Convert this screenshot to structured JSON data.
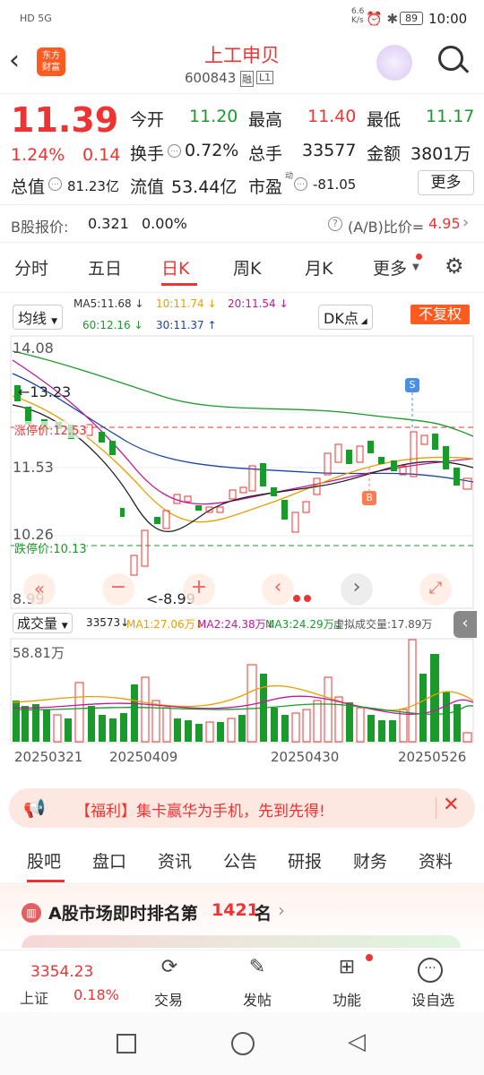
{
  "status": {
    "left_icons": "HD 5G",
    "speed": "6.6\nK/s",
    "battery": "89",
    "time": "10:00"
  },
  "header": {
    "logo": "东方\n财富",
    "title": "上工申贝",
    "code": "600843",
    "badge1": "融",
    "badge2": "L1"
  },
  "quote": {
    "price": "11.39",
    "pct": "1.24%",
    "chg": "0.14",
    "open_label": "今开",
    "open": "11.20",
    "high_label": "最高",
    "high": "11.40",
    "low_label": "最低",
    "low": "11.17",
    "turn_label": "换手",
    "turn": "0.72%",
    "vol_label": "总手",
    "vol": "33577",
    "amt_label": "金额",
    "amt": "3801万",
    "mcap_label": "总值",
    "mcap": "81.23亿",
    "float_label": "流值",
    "float": "53.44亿",
    "pe_label": "市盈",
    "pe_sup": "动",
    "pe": "-81.05",
    "more_btn": "更多"
  },
  "bshare": {
    "label": "B股报价:",
    "price": "0.321",
    "pct": "0.00%",
    "ratio_label": "(A/B)比价=",
    "ratio": "4.95"
  },
  "period_tabs": [
    "分时",
    "五日",
    "日K",
    "周K",
    "月K",
    "更多"
  ],
  "kline": {
    "ma_select": "均线",
    "ma5": "MA5:11.68 ↓",
    "ma10": "10:11.74 ↓",
    "ma20": "20:11.54 ↓",
    "ma60": "60:12.16 ↓",
    "ma30": "30:11.37 ↑",
    "dk": "DK点",
    "fq": "不复权",
    "y_top": "14.08",
    "y_mid": "11.53",
    "y_low": "10.26",
    "y_bot": "8.99",
    "max_label": "←13.23",
    "min_label": "<-8.99",
    "limit_up": "涨停价:12.53",
    "limit_down": "跌停价:10.13",
    "marker_s": "S",
    "marker_b": "B"
  },
  "volume": {
    "select": "成交量",
    "vol": "33573↓",
    "ma1": "MA1:27.06万↓",
    "ma2": "MA2:24.38万↓",
    "ma3": "MA3:24.29万↓",
    "virtual": "虚拟成交量:17.89万",
    "ymax": "58.81万",
    "dates": [
      "20250321",
      "20250409",
      "20250430",
      "20250526"
    ]
  },
  "banner": {
    "text": "【福利】集卡赢华为手机，先到先得!"
  },
  "bottom_tabs": [
    "股吧",
    "盘口",
    "资讯",
    "公告",
    "研报",
    "财务",
    "资料"
  ],
  "rank": {
    "prefix": "A股市场即时排名第",
    "rank": "1421",
    "suffix": "名"
  },
  "footer": {
    "index_price": "3354.23",
    "index_name": "上证",
    "index_pct": "0.18%",
    "trade": "交易",
    "post": "发帖",
    "func": "功能",
    "settings": "设自选"
  },
  "colors": {
    "up": "#e33333",
    "down": "#1a9a2a",
    "accent": "#ff5a1f"
  }
}
